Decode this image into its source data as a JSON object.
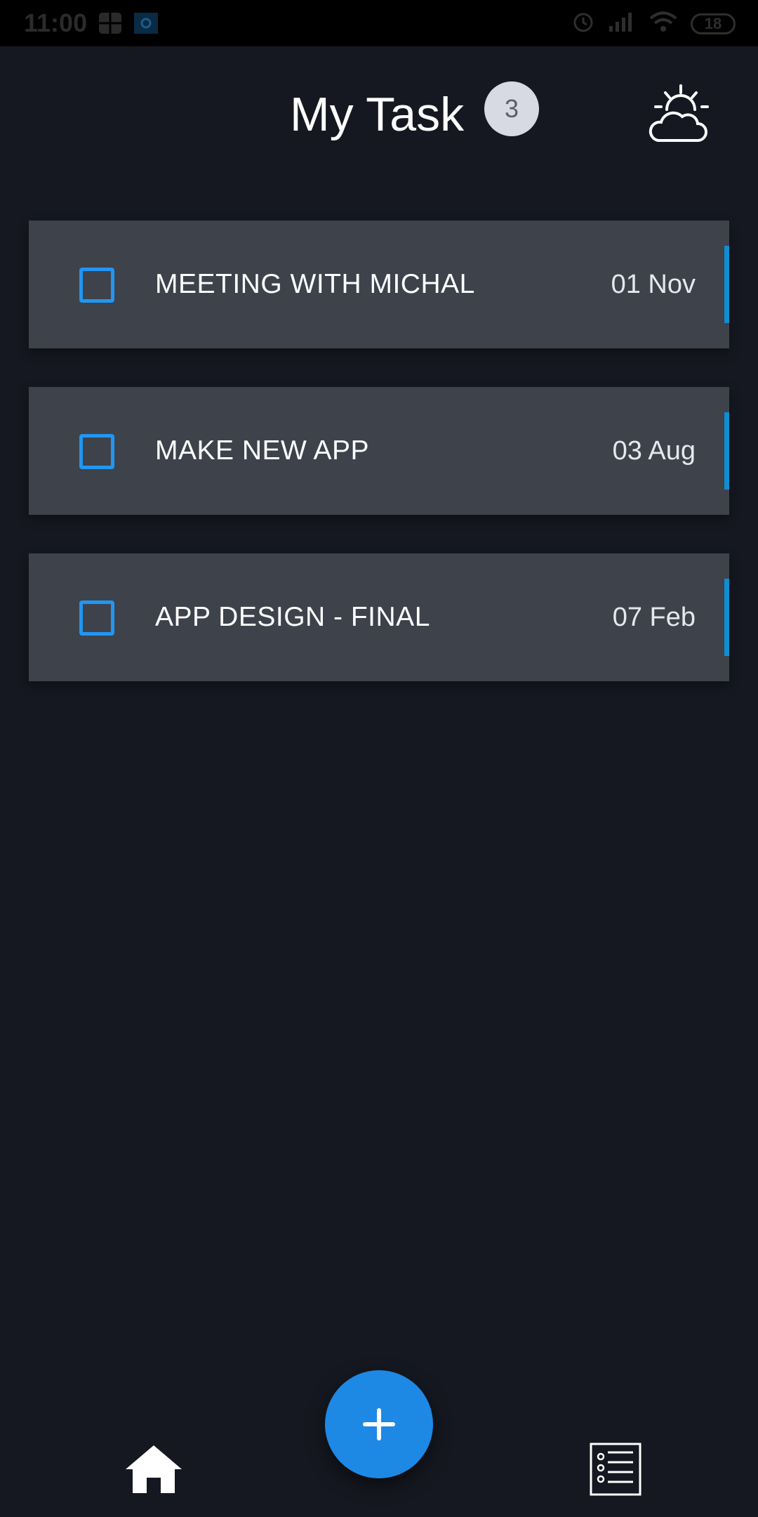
{
  "status_bar": {
    "time": "11:00",
    "battery": "18",
    "icons": [
      "grid-icon",
      "app-icon",
      "alarm-icon",
      "signal-icon",
      "wifi-icon",
      "battery-icon"
    ]
  },
  "header": {
    "title": "My Task",
    "count": "3",
    "weather_icon": "partly-cloudy-icon"
  },
  "tasks": [
    {
      "title": "MEETING WITH MICHAL",
      "date": "01 Nov",
      "checked": false
    },
    {
      "title": "MAKE NEW APP",
      "date": "03 Aug",
      "checked": false
    },
    {
      "title": "APP DESIGN - FINAL",
      "date": "07 Feb",
      "checked": false
    }
  ],
  "bottom_nav": {
    "home_icon": "home-icon",
    "list_icon": "task-list-icon",
    "fab_icon": "plus-icon"
  },
  "colors": {
    "background": "#151820",
    "card": "#3e424b",
    "accent": "#0d8fd3",
    "checkbox": "#2196f3",
    "fab": "#1e88e5"
  }
}
